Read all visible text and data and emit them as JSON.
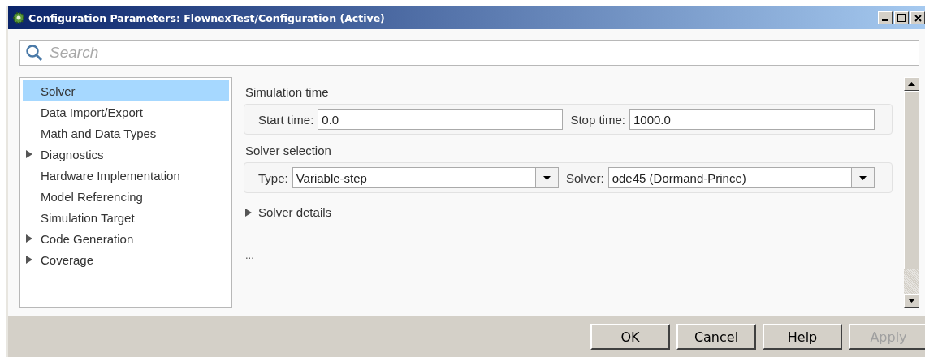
{
  "window": {
    "title": "Configuration Parameters: FlownexTest/Configuration (Active)"
  },
  "search": {
    "placeholder": "Search"
  },
  "sidebar": {
    "items": [
      {
        "label": "Solver",
        "selected": true,
        "expandable": false
      },
      {
        "label": "Data Import/Export",
        "selected": false,
        "expandable": false
      },
      {
        "label": "Math and Data Types",
        "selected": false,
        "expandable": false
      },
      {
        "label": "Diagnostics",
        "selected": false,
        "expandable": true
      },
      {
        "label": "Hardware Implementation",
        "selected": false,
        "expandable": false
      },
      {
        "label": "Model Referencing",
        "selected": false,
        "expandable": false
      },
      {
        "label": "Simulation Target",
        "selected": false,
        "expandable": false
      },
      {
        "label": "Code Generation",
        "selected": false,
        "expandable": true
      },
      {
        "label": "Coverage",
        "selected": false,
        "expandable": true
      }
    ]
  },
  "sections": [
    {
      "title": "Simulation time",
      "fields": [
        {
          "kind": "text",
          "label": "Start time:",
          "value": "0.0"
        },
        {
          "kind": "text",
          "label": "Stop time:",
          "value": "1000.0"
        }
      ]
    },
    {
      "title": "Solver selection",
      "fields": [
        {
          "kind": "dropdown",
          "label": "Type:",
          "value": "Variable-step"
        },
        {
          "kind": "dropdown",
          "label": "Solver:",
          "value": "ode45 (Dormand-Prince)"
        }
      ]
    }
  ],
  "details": {
    "label": "Solver details",
    "expanded": false
  },
  "more": "...",
  "buttons": [
    {
      "label": "OK",
      "disabled": false
    },
    {
      "label": "Cancel",
      "disabled": false
    },
    {
      "label": "Help",
      "disabled": false
    },
    {
      "label": "Apply",
      "disabled": true
    }
  ]
}
